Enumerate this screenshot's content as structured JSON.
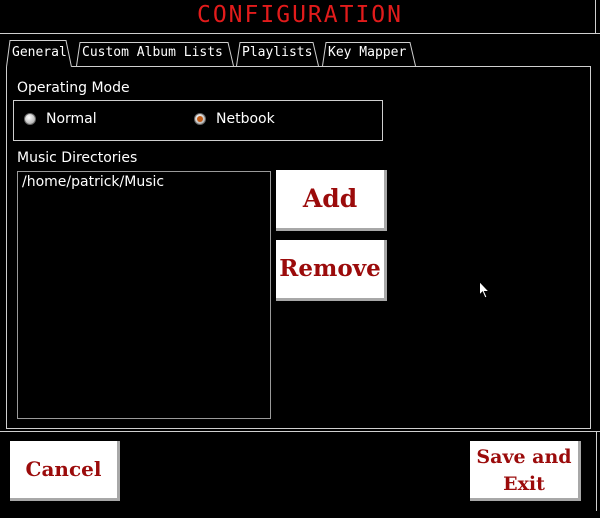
{
  "window": {
    "title": "CONFIGURATION"
  },
  "tabs": [
    {
      "label": "General",
      "active": true
    },
    {
      "label": "Custom Album Lists",
      "active": false
    },
    {
      "label": "Playlists",
      "active": false
    },
    {
      "label": "Key Mapper",
      "active": false
    }
  ],
  "general": {
    "operating_mode_label": "Operating Mode",
    "modes": [
      {
        "label": "Normal",
        "selected": false
      },
      {
        "label": "Netbook",
        "selected": true
      }
    ],
    "music_dirs_label": "Music Directories",
    "music_dirs": [
      "/home/patrick/Music"
    ],
    "add_label": "Add",
    "remove_label": "Remove"
  },
  "footer": {
    "cancel_label": "Cancel",
    "save_line1": "Save and",
    "save_line2": "Exit"
  },
  "colors": {
    "title": "#e21b1b",
    "button_text": "#9b0b0b",
    "background": "#000000",
    "border": "#cfcfcf"
  }
}
